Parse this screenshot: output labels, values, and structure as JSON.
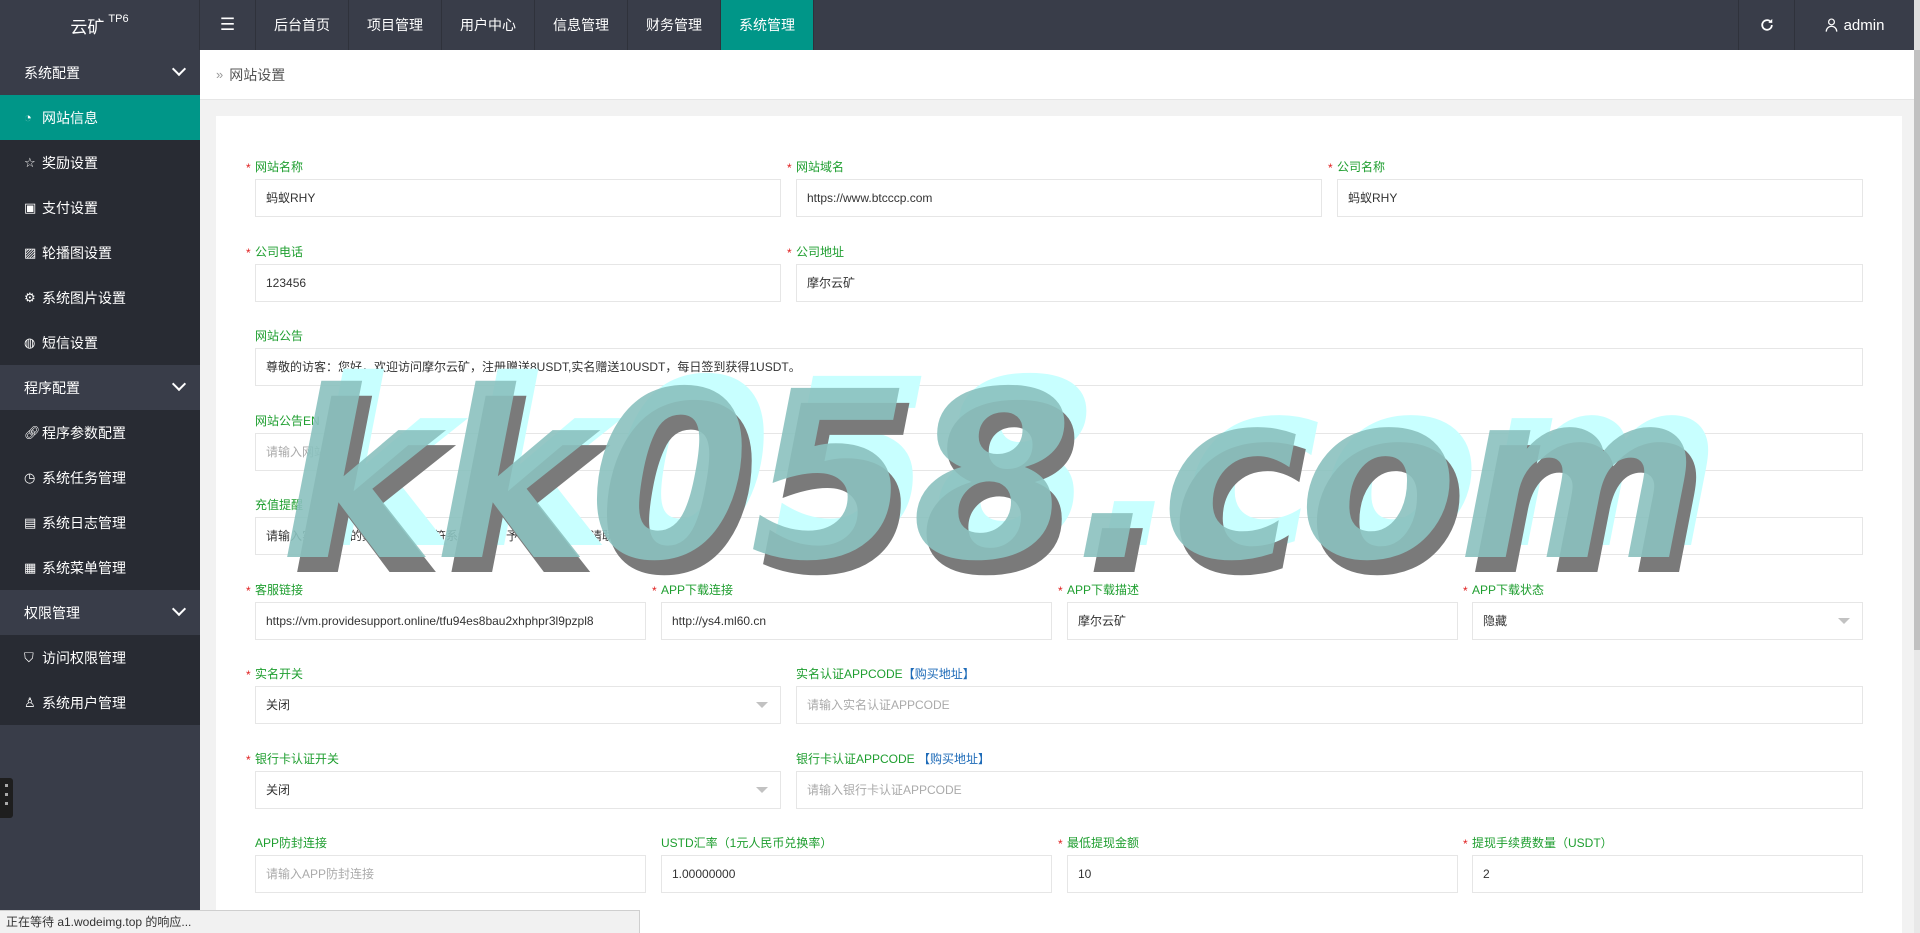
{
  "brand": {
    "name": "云矿",
    "version": "TP6"
  },
  "nav": {
    "toggle_icon": "menu-icon",
    "items": [
      {
        "label": "后台首页",
        "active": false
      },
      {
        "label": "项目管理",
        "active": false
      },
      {
        "label": "用户中心",
        "active": false
      },
      {
        "label": "信息管理",
        "active": false
      },
      {
        "label": "财务管理",
        "active": false
      },
      {
        "label": "系统管理",
        "active": true
      }
    ],
    "refresh_icon": "refresh-icon",
    "user": "admin",
    "user_icon": "user-icon"
  },
  "sidebar": {
    "groups": [
      {
        "label": "系统配置",
        "items": [
          {
            "label": "网站信息",
            "icon": "dashboard-icon",
            "active": true
          },
          {
            "label": "奖励设置",
            "icon": "star-icon"
          },
          {
            "label": "支付设置",
            "icon": "payment-icon"
          },
          {
            "label": "轮播图设置",
            "icon": "image-icon"
          },
          {
            "label": "系统图片设置",
            "icon": "gear-icon"
          },
          {
            "label": "短信设置",
            "icon": "message-icon"
          }
        ]
      },
      {
        "label": "程序配置",
        "items": [
          {
            "label": "程序参数配置",
            "icon": "link-icon"
          },
          {
            "label": "系统任务管理",
            "icon": "clock-icon"
          },
          {
            "label": "系统日志管理",
            "icon": "log-icon"
          },
          {
            "label": "系统菜单管理",
            "icon": "table-icon"
          }
        ]
      },
      {
        "label": "权限管理",
        "items": [
          {
            "label": "访问权限管理",
            "icon": "shield-icon"
          },
          {
            "label": "系统用户管理",
            "icon": "user-icon"
          }
        ]
      }
    ]
  },
  "breadcrumb": {
    "label": "网站设置"
  },
  "form": {
    "site_name": {
      "label": "网站名称",
      "value": "蚂蚁RHY"
    },
    "site_domain": {
      "label": "网站域名",
      "value": "https://www.btcccp.com"
    },
    "company_name": {
      "label": "公司名称",
      "value": "蚂蚁RHY"
    },
    "company_phone": {
      "label": "公司电话",
      "value": "123456"
    },
    "company_address": {
      "label": "公司地址",
      "value": "摩尔云矿"
    },
    "site_notice": {
      "label": "网站公告",
      "value": "尊敬的访客：您好，欢迎访问摩尔云矿，注册赠送8USDT,实名赠送10USDT，每日签到获得1USDT。"
    },
    "site_notice_en": {
      "label": "网站公告EN",
      "placeholder": "请输入网站公告"
    },
    "recharge_tip": {
      "label": "充值提醒",
      "value": "请输入实际提币的数量，数量不符系统将不给予审核。有问题请联系在线客服"
    },
    "service_link": {
      "label": "客服链接",
      "value": "https://vm.providesupport.online/tfu94es8bau2xhphpr3l9pzpl8"
    },
    "app_download_link": {
      "label": "APP下载连接",
      "value": "http://ys4.ml60.cn"
    },
    "app_download_desc": {
      "label": "APP下载描述",
      "value": "摩尔云矿"
    },
    "app_download_status": {
      "label": "APP下载状态",
      "value": "隐藏"
    },
    "realname_switch": {
      "label": "实名开关",
      "value": "关闭"
    },
    "realname_appcode": {
      "label": "实名认证APPCODE",
      "link": "【购买地址】",
      "placeholder": "请输入实名认证APPCODE"
    },
    "bankcard_switch": {
      "label": "银行卡认证开关",
      "value": "关闭"
    },
    "bankcard_appcode": {
      "label": "银行卡认证APPCODE",
      "link": "【购买地址】",
      "placeholder": "请输入银行卡认证APPCODE"
    },
    "app_antiblock": {
      "label": "APP防封连接",
      "placeholder": "请输入APP防封连接"
    },
    "usdt_rate": {
      "label": "USTD汇率（1元人民币兑换率）",
      "value": "1.00000000"
    },
    "min_withdraw": {
      "label": "最低提现金额",
      "value": "10"
    },
    "withdraw_fee": {
      "label": "提现手续费数量（USDT）",
      "value": "2"
    }
  },
  "statusbar": {
    "text": "正在等待 a1.wodeimg.top 的响应..."
  },
  "watermark": {
    "text": "kk058.com",
    "fill": "#8bc2bf",
    "shadow": "#7a7a7a",
    "highlight": "#c8ffff"
  }
}
